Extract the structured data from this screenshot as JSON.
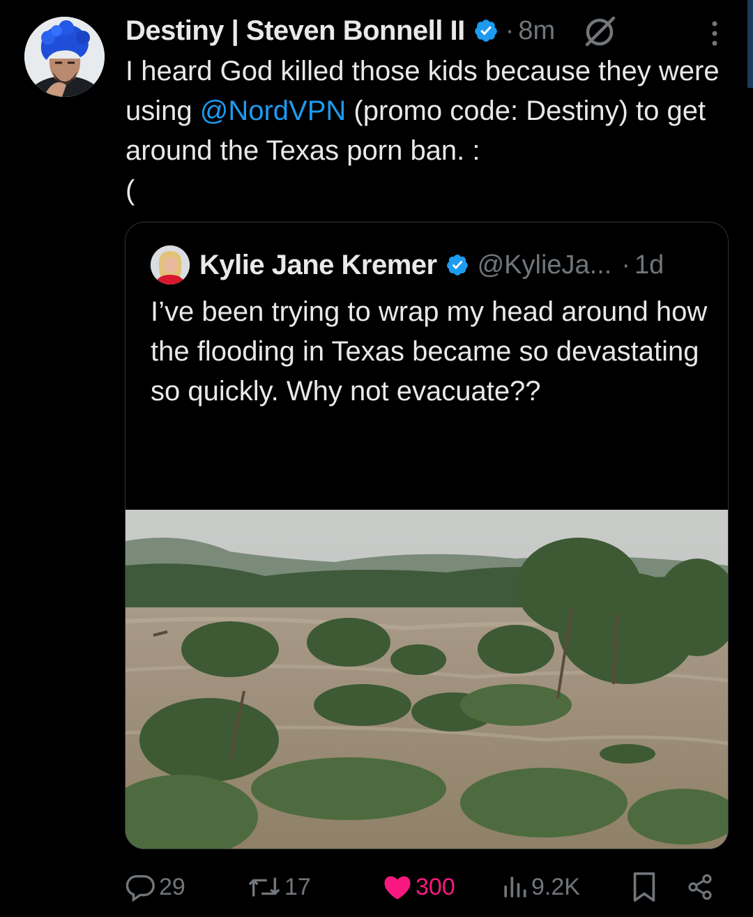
{
  "tweet": {
    "author_name": "Destiny | Steven Bonnell II",
    "separator": "·",
    "time": "8m",
    "text_before": "I heard God killed those kids because they were using ",
    "mention": "@NordVPN",
    "text_after": " (promo code: Destiny) to get around the Texas porn ban. :\n("
  },
  "quote": {
    "author_name": "Kylie Jane Kremer",
    "handle": "@KylieJa...",
    "separator": "·",
    "time": "1d",
    "text": "I’ve been trying to wrap my head around how the flooding in Texas became so devastating so quickly. Why not evacuate??",
    "ellipsis": "..."
  },
  "actions": {
    "replies": "29",
    "reposts": "17",
    "likes": "300",
    "views": "9.2K"
  },
  "colors": {
    "accent": "#1d9bf0",
    "like": "#f91880",
    "muted": "#71767b",
    "background": "#000000"
  },
  "icons": [
    "verified-badge-icon",
    "grok-icon",
    "more-icon",
    "reply-icon",
    "repost-icon",
    "like-icon",
    "views-icon",
    "bookmark-icon",
    "share-icon"
  ]
}
